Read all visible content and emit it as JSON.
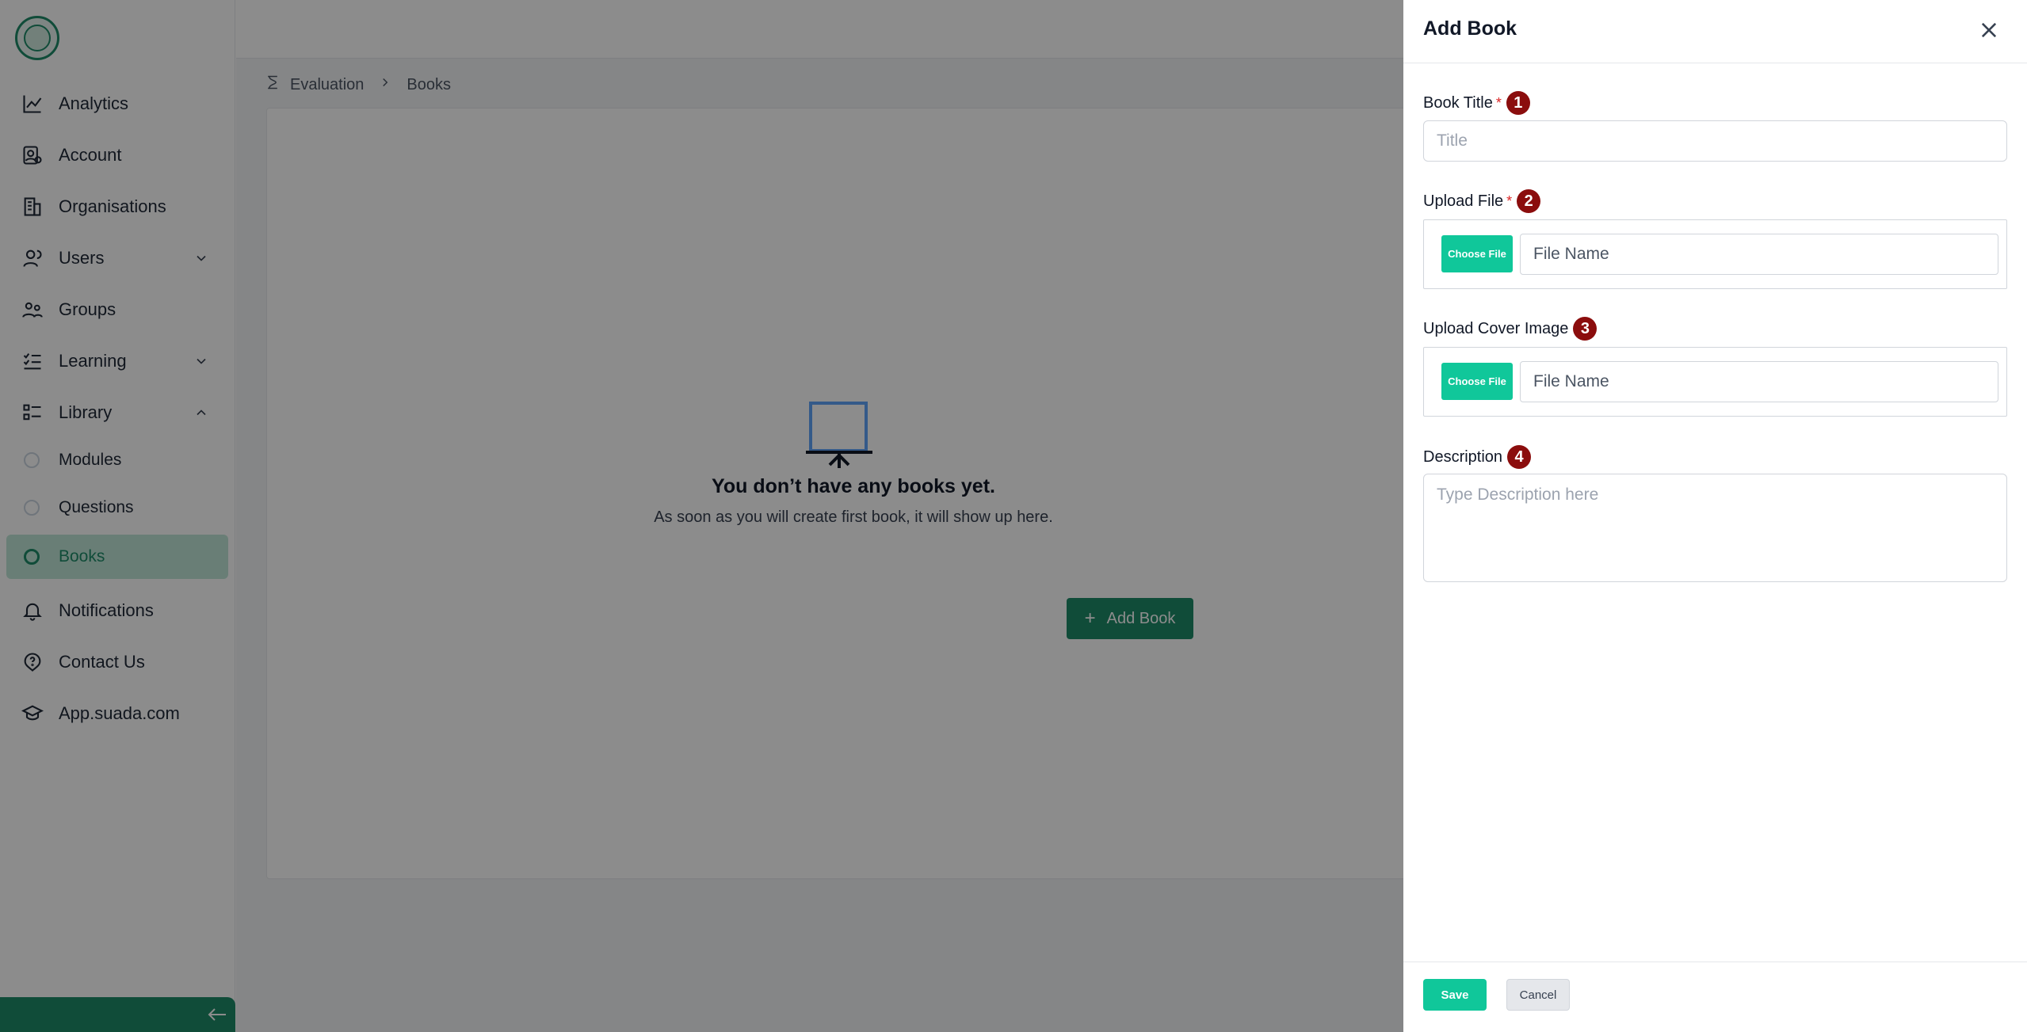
{
  "sidebar": {
    "items": [
      {
        "label": "Analytics",
        "icon": "chart-line-icon"
      },
      {
        "label": "Account",
        "icon": "user-gear-icon"
      },
      {
        "label": "Organisations",
        "icon": "building-icon"
      },
      {
        "label": "Users",
        "icon": "user-icon"
      },
      {
        "label": "Groups",
        "icon": "users-icon"
      },
      {
        "label": "Learning",
        "icon": "checklist-icon"
      },
      {
        "label": "Library",
        "icon": "list-icon"
      },
      {
        "label": "Notifications",
        "icon": "bell-icon"
      },
      {
        "label": "Contact Us",
        "icon": "help-circle-icon"
      },
      {
        "label": "App.suada.com",
        "icon": "graduation-cap-icon"
      }
    ],
    "library_sub": [
      {
        "label": "Modules"
      },
      {
        "label": "Questions"
      },
      {
        "label": "Books"
      }
    ]
  },
  "breadcrumb": {
    "items": [
      "Evaluation",
      "Books"
    ]
  },
  "empty_state": {
    "title": "You don’t have any books yet.",
    "subtitle": "As soon as you will create first book, it will show up here.",
    "button": "Add Book"
  },
  "drawer": {
    "title": "Add Book",
    "book_title": {
      "label": "Book Title",
      "badge": "1",
      "placeholder": "Title"
    },
    "upload_file": {
      "label": "Upload File",
      "badge": "2",
      "button": "Choose File",
      "placeholder": "File Name"
    },
    "upload_cover": {
      "label": "Upload Cover Image",
      "badge": "3",
      "button": "Choose File",
      "placeholder": "File Name"
    },
    "description": {
      "label": "Description",
      "badge": "4",
      "placeholder": "Type Description here"
    },
    "required_mark": "*",
    "save": "Save",
    "cancel": "Cancel"
  },
  "colors": {
    "brand": "#1e8a68",
    "accent": "#10c79a",
    "badge": "#8b0d0d"
  }
}
